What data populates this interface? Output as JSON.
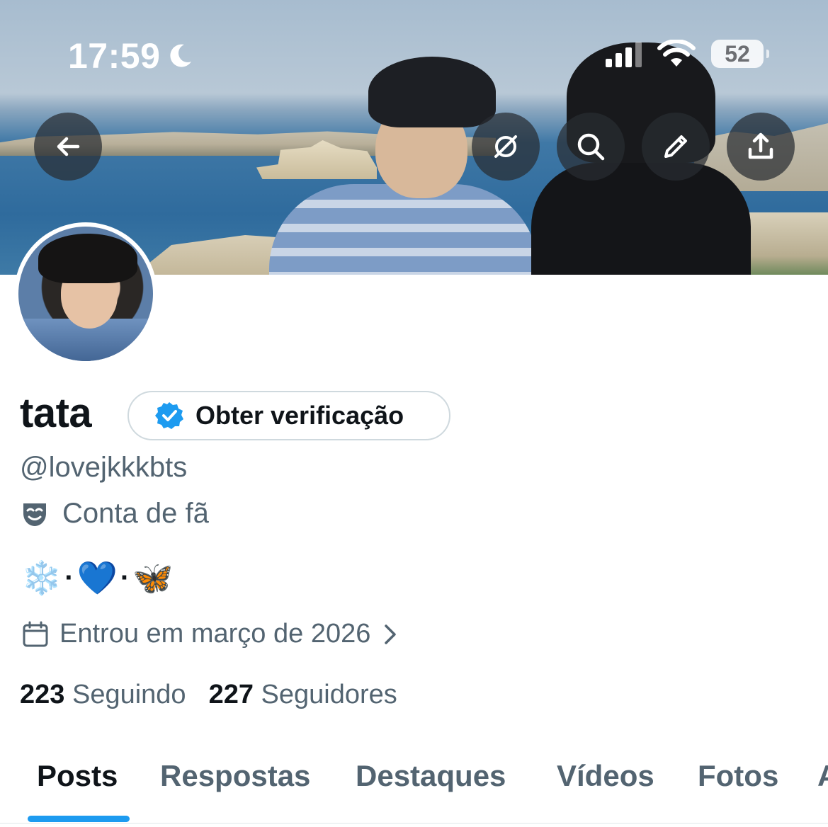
{
  "status_bar": {
    "time": "17:59",
    "battery": "52",
    "icons": [
      "moon-icon",
      "cellular-signal-icon",
      "wifi-icon",
      "battery-icon"
    ]
  },
  "header_actions": {
    "icons": [
      "back-arrow-icon",
      "grok-icon",
      "search-icon",
      "pencil-icon",
      "share-icon"
    ]
  },
  "profile": {
    "display_name": "tata",
    "verify_label": "Obter verificação",
    "handle": "@lovejkkkbts",
    "category": "Conta de fã",
    "bio_emojis": [
      "❄️",
      "·",
      "💙",
      "·",
      "🦋"
    ],
    "joined": "Entrou em março de 2026",
    "following_count": "223",
    "following_label": "Seguindo",
    "followers_count": "227",
    "followers_label": "Seguidores"
  },
  "tabs": [
    {
      "label": "Posts",
      "active": true
    },
    {
      "label": "Respostas",
      "active": false
    },
    {
      "label": "Destaques",
      "active": false
    },
    {
      "label": "Vídeos",
      "active": false
    },
    {
      "label": "Fotos",
      "active": false
    },
    {
      "label": "A",
      "active": false
    }
  ],
  "colors": {
    "accent": "#1d9bf0",
    "secondary_text": "#536471",
    "primary_text": "#0f1419",
    "border": "#cfd9de"
  }
}
